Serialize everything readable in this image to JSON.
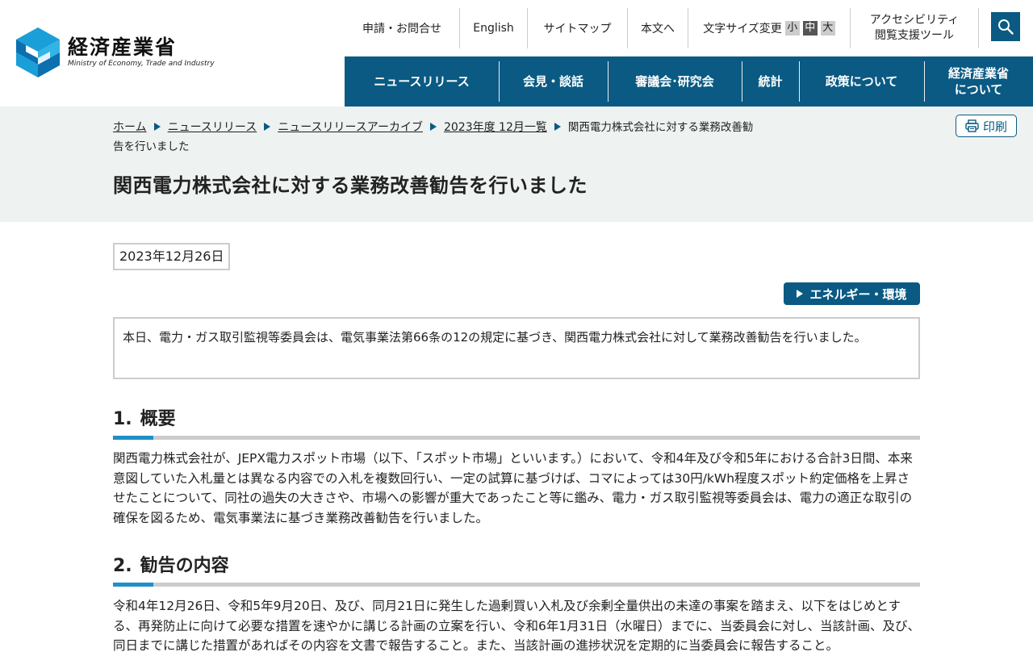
{
  "header": {
    "logo_name": "経済産業省",
    "logo_en": "Ministry of Economy, Trade and Industry",
    "util": {
      "contact": "申請・お問合せ",
      "english": "English",
      "sitemap": "サイトマップ",
      "to_main": "本文へ",
      "font_size_label": "文字サイズ変更",
      "font_small": "小",
      "font_medium": "中",
      "font_large": "大",
      "accessibility_line1": "アクセシビリティ",
      "accessibility_line2": "閲覧支援ツール"
    },
    "gnav": {
      "news": "ニュースリリース",
      "press": "会見・談話",
      "council": "審議会･研究会",
      "stats": "統計",
      "policy": "政策について",
      "about_line1": "経済産業省",
      "about_line2": "について"
    },
    "accent_color": "#0a5a83"
  },
  "breadcrumb": {
    "home": "ホーム",
    "news": "ニュースリリース",
    "archive": "ニュースリリースアーカイブ",
    "month": "2023年度 12月一覧",
    "current_line1": "関西電力株式会社に対する業務改善勧",
    "current_line2": "告を行いました"
  },
  "print_label": "印刷",
  "page_title": "関西電力株式会社に対する業務改善勧告を行いました",
  "date": "2023年12月26日",
  "category": "エネルギー・環境",
  "summary": "本日、電力・ガス取引監視等委員会は、電気事業法第66条の12の規定に基づき、関西電力株式会社に対して業務改善勧告を行いました。",
  "sections": [
    {
      "num": "1.",
      "title": "概要",
      "body": "関西電力株式会社が、JEPX電力スポット市場（以下、「スポット市場」といいます。）において、令和4年及び令和5年における合計3日間、本来意図していた入札量とは異なる内容での入札を複数回行い、一定の試算に基づけば、コマによっては30円/kWh程度スポット約定価格を上昇させたことについて、同社の過失の大きさや、市場への影響が重大であったこと等に鑑み、電力・ガス取引監視等委員会は、電力の適正な取引の確保を図るため、電気事業法に基づき業務改善勧告を行いました。"
    },
    {
      "num": "2.",
      "title": "勧告の内容",
      "body": "令和4年12月26日、令和5年9月20日、及び、同月21日に発生した過剰買い入札及び余剰全量供出の未達の事案を踏まえ、以下をはじめとする、再発防止に向けて必要な措置を速やかに講じる計画の立案を行い、令和6年1月31日（水曜日）までに、当委員会に対し、当該計画、及び、同日までに講じた措置があればその内容を文書で報告すること。また、当該計画の進捗状況を定期的に当委員会に報告すること。"
    }
  ]
}
